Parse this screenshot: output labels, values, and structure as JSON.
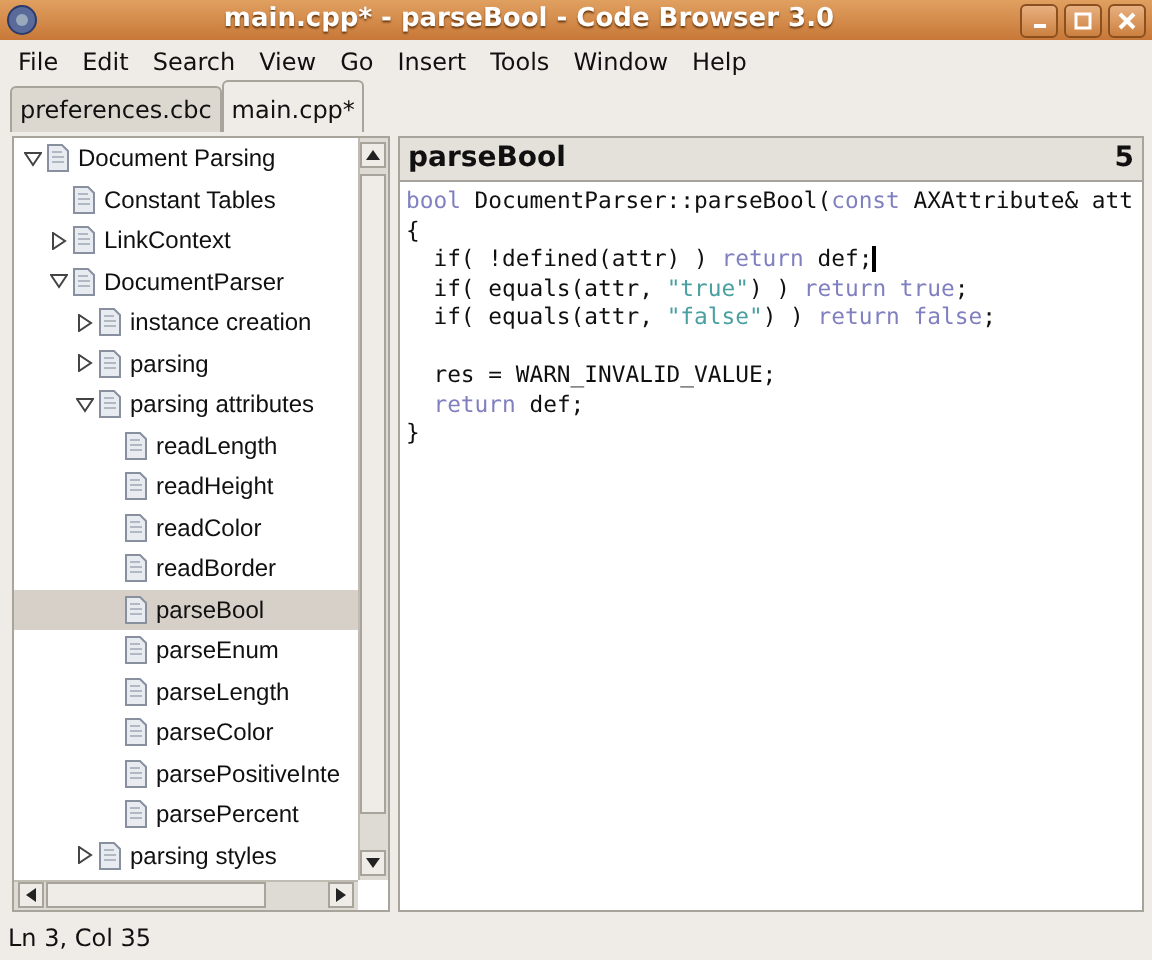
{
  "window": {
    "title": "main.cpp* - parseBool - Code Browser 3.0"
  },
  "menu": [
    "File",
    "Edit",
    "Search",
    "View",
    "Go",
    "Insert",
    "Tools",
    "Window",
    "Help"
  ],
  "tabs": [
    {
      "label": "preferences.cbc",
      "selected": false
    },
    {
      "label": "main.cpp*",
      "selected": true
    }
  ],
  "tree": [
    {
      "label": "Document Parsing",
      "expanded": true,
      "selected": false,
      "children": [
        {
          "label": "Constant Tables",
          "selected": false
        },
        {
          "label": "LinkContext",
          "expanded": false,
          "selected": false
        },
        {
          "label": "DocumentParser",
          "expanded": true,
          "selected": false,
          "children": [
            {
              "label": "instance creation",
              "expanded": false,
              "selected": false
            },
            {
              "label": "parsing",
              "expanded": false,
              "selected": false
            },
            {
              "label": "parsing attributes",
              "expanded": true,
              "selected": false,
              "children": [
                {
                  "label": "readLength",
                  "selected": false
                },
                {
                  "label": "readHeight",
                  "selected": false
                },
                {
                  "label": "readColor",
                  "selected": false
                },
                {
                  "label": "readBorder",
                  "selected": false
                },
                {
                  "label": "parseBool",
                  "selected": true
                },
                {
                  "label": "parseEnum",
                  "selected": false
                },
                {
                  "label": "parseLength",
                  "selected": false
                },
                {
                  "label": "parseColor",
                  "selected": false
                },
                {
                  "label": "parsePositiveInte",
                  "selected": false
                },
                {
                  "label": "parsePercent",
                  "selected": false
                }
              ]
            },
            {
              "label": "parsing styles",
              "expanded": false,
              "selected": false
            }
          ]
        }
      ]
    }
  ],
  "editor": {
    "title": "parseBool",
    "count": "5",
    "lines": [
      {
        "has_cursor": false,
        "tokens": [
          {
            "kind": "keyword",
            "text": "bool"
          },
          {
            "kind": "plain",
            "text": " DocumentParser::parseBool("
          },
          {
            "kind": "keyword",
            "text": "const"
          },
          {
            "kind": "plain",
            "text": " AXAttribute& att"
          }
        ]
      },
      {
        "has_cursor": false,
        "tokens": [
          {
            "kind": "plain",
            "text": "{"
          }
        ]
      },
      {
        "has_cursor": true,
        "tokens": [
          {
            "kind": "plain",
            "text": "  if( !defined(attr) ) "
          },
          {
            "kind": "keyword",
            "text": "return"
          },
          {
            "kind": "plain",
            "text": " def;"
          }
        ]
      },
      {
        "has_cursor": false,
        "tokens": [
          {
            "kind": "plain",
            "text": "  if( equals(attr, "
          },
          {
            "kind": "string",
            "text": "\"true\""
          },
          {
            "kind": "plain",
            "text": ") ) "
          },
          {
            "kind": "keyword",
            "text": "return true"
          },
          {
            "kind": "plain",
            "text": ";"
          }
        ]
      },
      {
        "has_cursor": false,
        "tokens": [
          {
            "kind": "plain",
            "text": "  if( equals(attr, "
          },
          {
            "kind": "string",
            "text": "\"false\""
          },
          {
            "kind": "plain",
            "text": ") ) "
          },
          {
            "kind": "keyword",
            "text": "return false"
          },
          {
            "kind": "plain",
            "text": ";"
          }
        ]
      },
      {
        "kind": "blank"
      },
      {
        "has_cursor": false,
        "tokens": [
          {
            "kind": "plain",
            "text": "  res = WARN_INVALID_VALUE;"
          }
        ]
      },
      {
        "has_cursor": false,
        "tokens": [
          {
            "kind": "keyword",
            "text": "  return"
          },
          {
            "kind": "plain",
            "text": " def;"
          }
        ]
      },
      {
        "has_cursor": false,
        "tokens": [
          {
            "kind": "plain",
            "text": "}"
          }
        ]
      }
    ]
  },
  "status_bar": "Ln 3, Col 35"
}
